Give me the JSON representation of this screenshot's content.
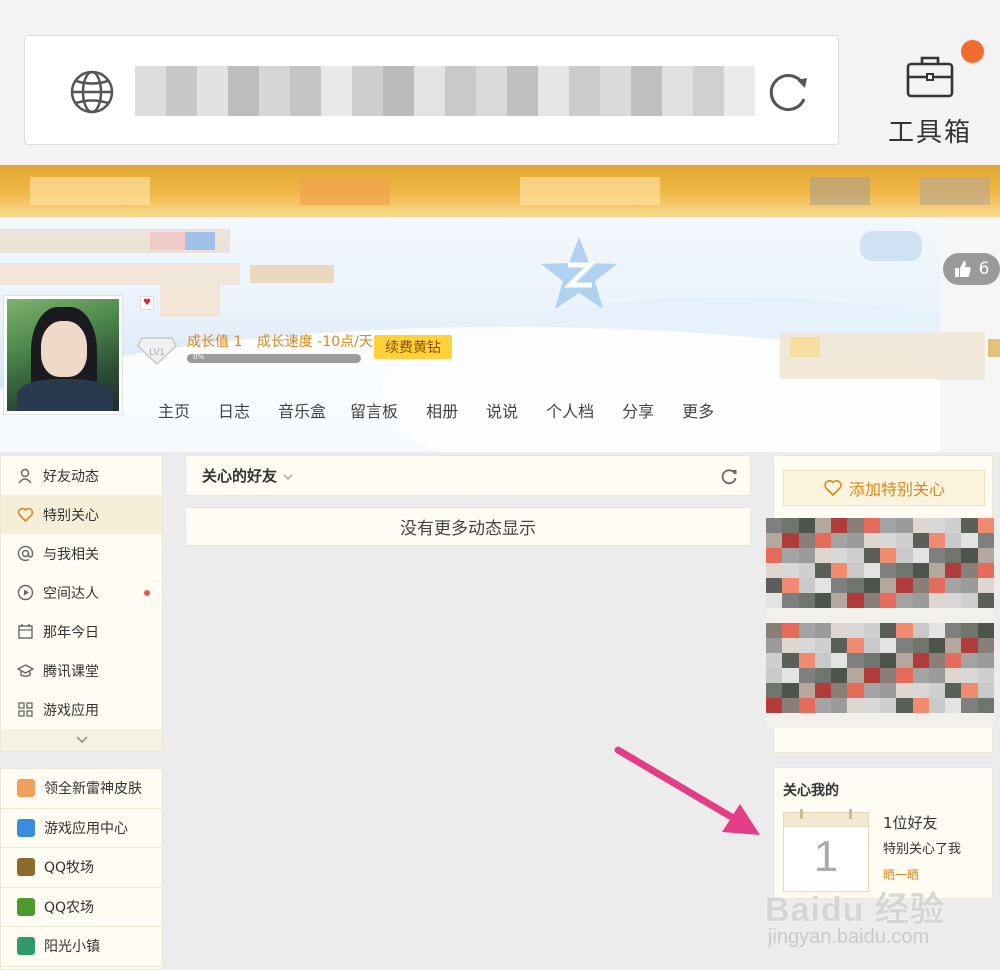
{
  "toolbar": {
    "toolbox_label": "工具箱",
    "notification_dot_color": "#f26b2e"
  },
  "profile": {
    "level_badge": "LV1",
    "growth_value": "成长值 1",
    "growth_speed": "成长速度 -10点/天",
    "renew_label": "续费黄钻",
    "progress_text": "0%",
    "progress_value": 0,
    "likes_count": "6"
  },
  "nav": {
    "items": [
      "主页",
      "日志",
      "音乐盒",
      "留言板",
      "相册",
      "说说",
      "个人档",
      "分享",
      "更多"
    ]
  },
  "sidebar": {
    "items": [
      {
        "label": "好友动态",
        "icon": "person-icon"
      },
      {
        "label": "特别关心",
        "icon": "heart-icon",
        "active": true
      },
      {
        "label": "与我相关",
        "icon": "at-icon"
      },
      {
        "label": "空间达人",
        "icon": "play-circle-icon",
        "dot": true
      },
      {
        "label": "那年今日",
        "icon": "calendar-icon"
      },
      {
        "label": "腾讯课堂",
        "icon": "graduation-cap-icon"
      },
      {
        "label": "游戏应用",
        "icon": "grid-icon"
      }
    ],
    "apps": [
      {
        "label": "领全新雷神皮肤",
        "icon": "sound-icon",
        "color": "#f0a05a"
      },
      {
        "label": "游戏应用中心",
        "icon": "game-center-icon",
        "color": "#3a8ddc"
      },
      {
        "label": "QQ牧场",
        "icon": "ranch-icon",
        "color": "#8b6a2e"
      },
      {
        "label": "QQ农场",
        "icon": "farm-icon",
        "color": "#4c9a2a"
      },
      {
        "label": "阳光小镇",
        "icon": "town-icon",
        "color": "#2f9a6a"
      }
    ]
  },
  "feed": {
    "filter_label": "关心的好友",
    "empty_message": "没有更多动态显示"
  },
  "right": {
    "add_care_label": "添加特别关心",
    "care_me_title": "关心我的",
    "calendar_number": "1",
    "care_count": "1位好友",
    "care_text": "特别关心了我",
    "share_link": "晒一晒"
  },
  "watermark": {
    "brand": "Baidu 经验",
    "url": "jingyan.baidu.com"
  },
  "colors": {
    "accent_orange": "#d9881e",
    "arrow_pink": "#e23d86",
    "gold": "#e2a531"
  }
}
